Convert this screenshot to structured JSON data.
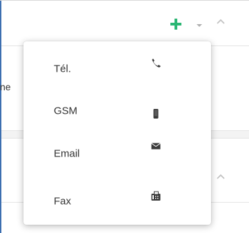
{
  "background": {
    "partial_text": "ne"
  },
  "toolbar": {
    "add_icon": "plus-icon",
    "caret_icon": "caret-down-icon",
    "collapse_icon": "chevron-up-icon"
  },
  "dropdown": {
    "items": [
      {
        "label": "Tél.",
        "icon": "phone-icon"
      },
      {
        "label": "GSM",
        "icon": "mobile-icon"
      },
      {
        "label": "Email",
        "icon": "envelope-icon"
      },
      {
        "label": "Fax",
        "icon": "fax-icon"
      }
    ]
  },
  "colors": {
    "accent_green": "#2bb673",
    "icon_gray": "#3a3a3a",
    "panel_border": "#3d6fb0"
  }
}
